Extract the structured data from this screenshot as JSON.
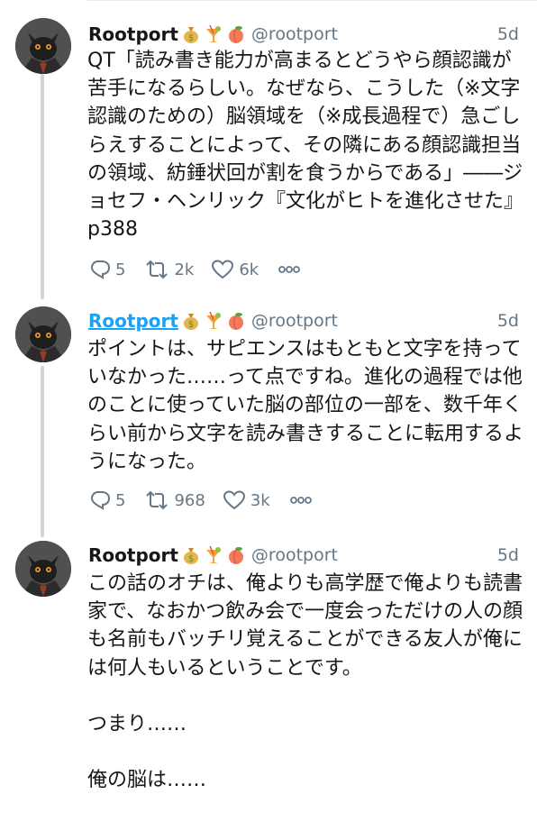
{
  "tweets": [
    {
      "name": "Rootport",
      "handle": "@rootport",
      "time": "5d",
      "emojis": [
        "money-bag",
        "tropical-drink",
        "peach"
      ],
      "text": "QT「読み書き能力が高まるとどうやら顔認識が苦手になるらしい。なぜなら、こうした（※文字認識のための）脳領域を（※成長過程で）急ごしらえすることによって、その隣にある顔認識担当の領域、紡錘状回が割を食うからである」――ジョセフ・ヘンリック『文化がヒトを進化させた』p388",
      "replies": "5",
      "retweets": "2k",
      "likes": "6k"
    },
    {
      "name": "Rootport",
      "handle": "@rootport",
      "time": "5d",
      "emojis": [
        "money-bag",
        "tropical-drink",
        "peach"
      ],
      "text": "ポイントは、サピエンスはもともと文字を持っていなかった……って点ですね。進化の過程では他のことに使っていた脳の部位の一部を、数千年くらい前から文字を読み書きすることに転用するようになった。",
      "replies": "5",
      "retweets": "968",
      "likes": "3k"
    },
    {
      "name": "Rootport",
      "handle": "@rootport",
      "time": "5d",
      "emojis": [
        "money-bag",
        "tropical-drink",
        "peach"
      ],
      "text1": "この話のオチは、俺よりも高学歴で俺よりも読書家で、なおかつ飲み会で一度会っただけの人の顔も名前もバッチリ覚えることができる友人が俺には何人もいるということです。",
      "text2": "つまり……",
      "text3": "俺の脳は……"
    }
  ]
}
